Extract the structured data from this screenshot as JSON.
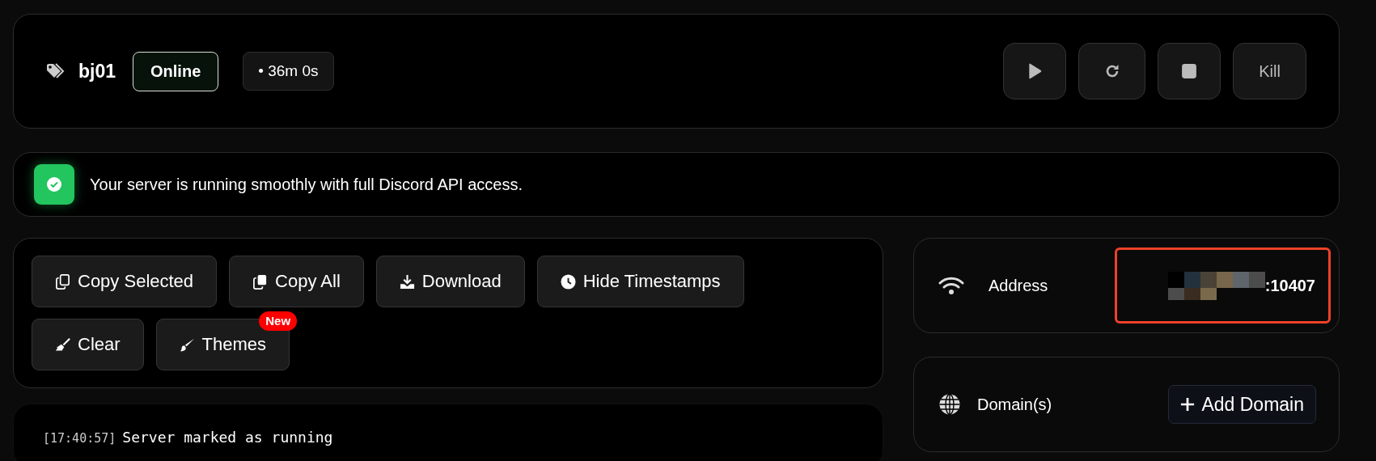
{
  "server": {
    "name": "bj01",
    "status": "Online",
    "uptime": "• 36m 0s"
  },
  "power_buttons": [
    {
      "kind": "start"
    },
    {
      "kind": "restart"
    },
    {
      "kind": "stop"
    },
    {
      "kind": "kill",
      "label": "Kill"
    }
  ],
  "notice": {
    "kind": "success",
    "text": "Your server is running smoothly with full Discord API access."
  },
  "console_tools": [
    {
      "kind": "copy",
      "label": "Copy Selected"
    },
    {
      "kind": "copies",
      "label": "Copy All"
    },
    {
      "kind": "download",
      "label": "Download"
    },
    {
      "kind": "clock",
      "label": "Hide Timestamps"
    },
    {
      "kind": "broom",
      "label": "Clear"
    },
    {
      "kind": "brush",
      "label": "Themes",
      "badge": "New"
    }
  ],
  "console_lines": [
    {
      "time": "[17:40:57]",
      "text": "Server marked as running"
    }
  ],
  "address": {
    "label": "Address",
    "value": ":10407",
    "redacted": true,
    "highlighted": true
  },
  "domains": {
    "label": "Domain(s)",
    "button": "Add Domain"
  }
}
